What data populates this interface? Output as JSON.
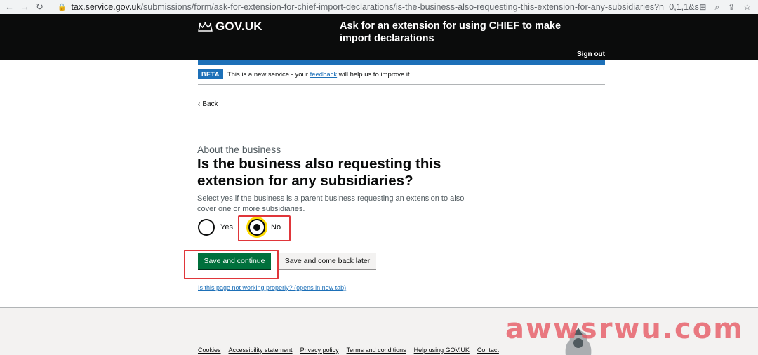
{
  "browser": {
    "url_domain": "tax.service.gov.uk",
    "url_path": "/submissions/form/ask-for-extension-for-chief-import-declarations/is-the-business-also-requesting-this-extension-for-any-subsidiaries?n=0,1,1&se=t&..."
  },
  "header": {
    "logo_text": "GOV.UK",
    "service_name": "Ask for an extension for using CHIEF to make import declarations",
    "sign_out": "Sign out"
  },
  "phase": {
    "tag": "BETA",
    "text_before": "This is a new service - your",
    "link": "feedback",
    "text_after": "will help us to improve it."
  },
  "back_link": "Back",
  "question": {
    "caption": "About the business",
    "heading": "Is the business also requesting this extension for any subsidiaries?",
    "hint": "Select yes if the business is a parent business requesting an extension to also cover one or more subsidiaries.",
    "options": [
      {
        "label": "Yes",
        "checked": false
      },
      {
        "label": "No",
        "checked": true
      }
    ]
  },
  "buttons": {
    "save_continue": "Save and continue",
    "save_later": "Save and come back later"
  },
  "report_link": "Is this page not working properly? (opens in new tab)",
  "footer": {
    "links": [
      "Cookies",
      "Accessibility statement",
      "Privacy policy",
      "Terms and conditions",
      "Help using GOV.UK",
      "Contact"
    ]
  },
  "watermark": "awwsrwu.com",
  "colors": {
    "header_bg": "#0b0c0c",
    "govuk_blue": "#1d70b8",
    "button_green": "#00703c",
    "focus_yellow": "#ffdd00",
    "highlight_red": "#e0363a"
  }
}
